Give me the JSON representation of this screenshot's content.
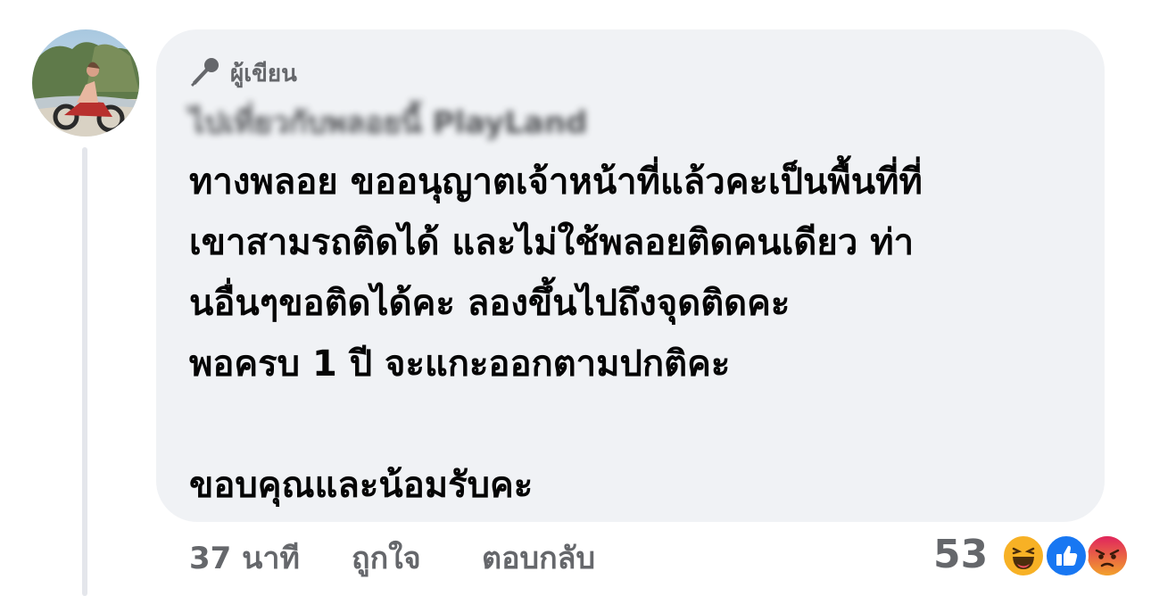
{
  "comment": {
    "author_badge_label": "ผู้เขียน",
    "author_name": "ไปเที่ยวกับพลอยนี้ PlayLand",
    "body_lines": [
      "ทางพลอย ขออนุญาตเจ้าหน้าที่แล้วคะเป็นพื้นที่ที่",
      "เขาสามรถติดได้ และไม่ใช้พลอยติดคนเดียว ท่า",
      "นอื่นๆขอติดได้คะ ลองขึ้นไปถึงจุดติดคะ",
      "พอครบ 1 ปี จะแกะออกตามปกติคะ",
      "",
      "ขอบคุณและน้อมรับคะ"
    ]
  },
  "actions": {
    "timestamp": "37 นาที",
    "like_label": "ถูกใจ",
    "reply_label": "ตอบกลับ"
  },
  "reactions": {
    "count": "53",
    "types": [
      "haha-icon",
      "like-icon",
      "angry-icon"
    ]
  },
  "colors": {
    "bubble_bg": "#f0f2f5",
    "meta_text": "#65676b",
    "like_blue": "#1877f2",
    "haha_yellow": "#f7b125",
    "angry_red": "#e9710f"
  }
}
